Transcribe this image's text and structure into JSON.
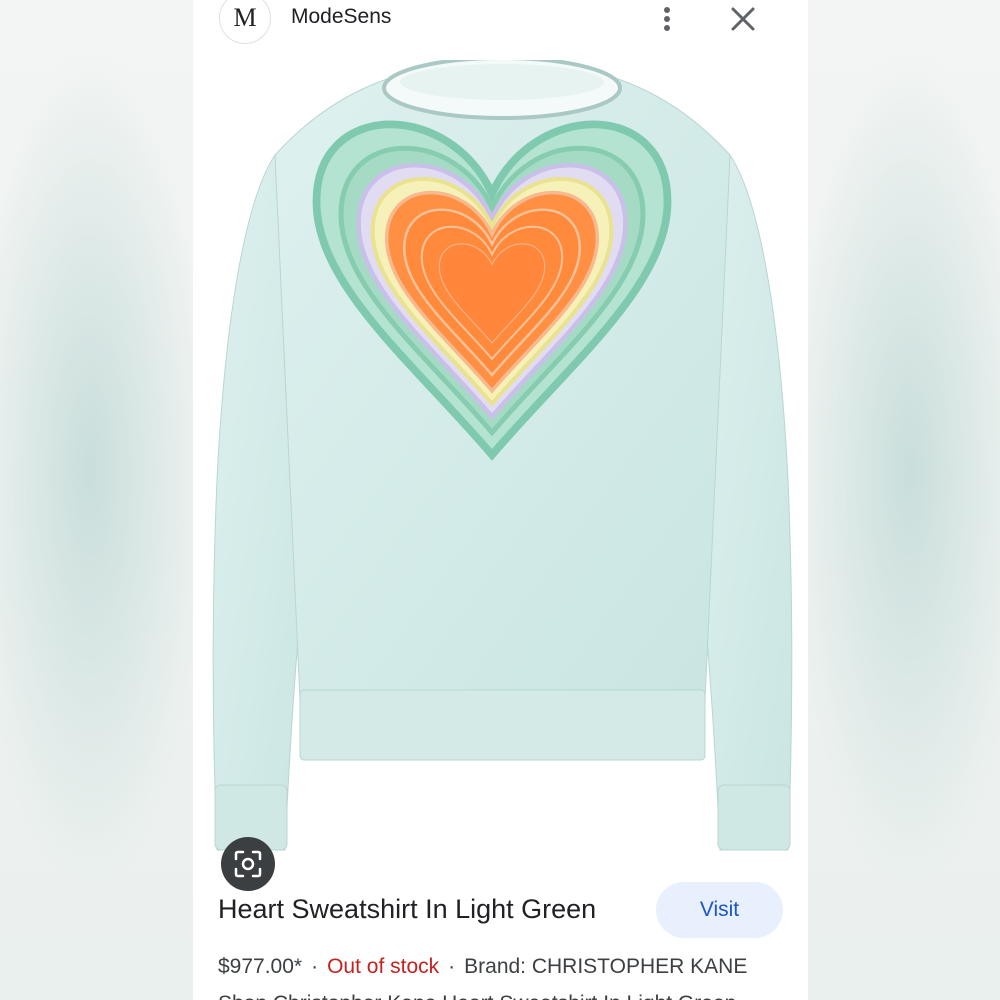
{
  "header": {
    "logo_letter": "M",
    "site_name": "ModeSens"
  },
  "product": {
    "image_alt": "Light green sweatshirt with embroidered rainbow heart",
    "title": "Heart Sweatshirt In Light Green",
    "visit_label": "Visit",
    "price": "$977.00*",
    "separator": "·",
    "stock_status": "Out of stock",
    "brand": "Brand: CHRISTOPHER KANE",
    "description_partial": "Shop Christopher Kane Heart Sweatshirt In Light Green"
  },
  "icons": {
    "more": "more-vert-icon",
    "close": "close-icon",
    "lens": "lens-search-icon"
  },
  "colors": {
    "sweater": "#d6ecea",
    "heart_outer": "#8fd3b8",
    "heart_orange": "#ff8a3c",
    "accent_blue": "#1a56c8",
    "out_of_stock_red": "#c5221f"
  }
}
